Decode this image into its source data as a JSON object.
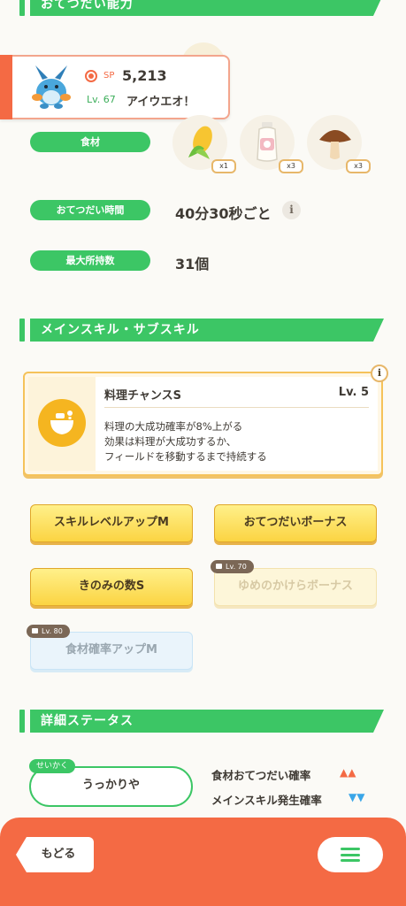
{
  "sections": {
    "helping": "おてつだい能力",
    "skills": "メインスキル・サブスキル",
    "details": "詳細ステータス"
  },
  "pokemon": {
    "sp_label": "SP",
    "sp_value": "5,213",
    "level": "Lv. 67",
    "name": "アイウエオ！"
  },
  "stats": {
    "ingredients_label": "食材",
    "helping_time_label": "おてつだい時間",
    "helping_time_value": "40分30秒ごと",
    "max_carry_label": "最大所持数",
    "max_carry_value": "31個",
    "ingredients": [
      {
        "icon": "corn-icon",
        "count": "x1"
      },
      {
        "icon": "milk-icon",
        "count": "x3"
      },
      {
        "icon": "mushroom-icon",
        "count": "x3"
      }
    ]
  },
  "main_skill": {
    "name": "料理チャンスS",
    "level": "Lv. 5",
    "desc_line1": "料理の大成功確率が8%上がる",
    "desc_line2": "効果は料理が大成功するか、",
    "desc_line3": "フィールドを移動するまで持続する",
    "info_label": "i"
  },
  "sub_skills": [
    {
      "label": "スキルレベルアップM",
      "state": "active"
    },
    {
      "label": "おてつだいボーナス",
      "state": "active"
    },
    {
      "label": "きのみの数S",
      "state": "active"
    },
    {
      "label": "ゆめのかけらボーナス",
      "state": "locked",
      "lock": "Lv. 70"
    },
    {
      "label": "食材確率アップM",
      "state": "locked",
      "lock": "Lv. 80"
    }
  ],
  "nature": {
    "tag": "せいかく",
    "name": "うっかりや",
    "up_label": "食材おてつだい確率",
    "up_arrows": "▲▲",
    "down_label": "メインスキル発生確率",
    "down_arrows": "▼▼"
  },
  "footer": {
    "back_label": "もどる"
  },
  "colors": {
    "green": "#3cc665",
    "orange": "#f46a44",
    "yellow": "#fbd442",
    "up": "#f46a44",
    "down": "#3aa6e8"
  }
}
